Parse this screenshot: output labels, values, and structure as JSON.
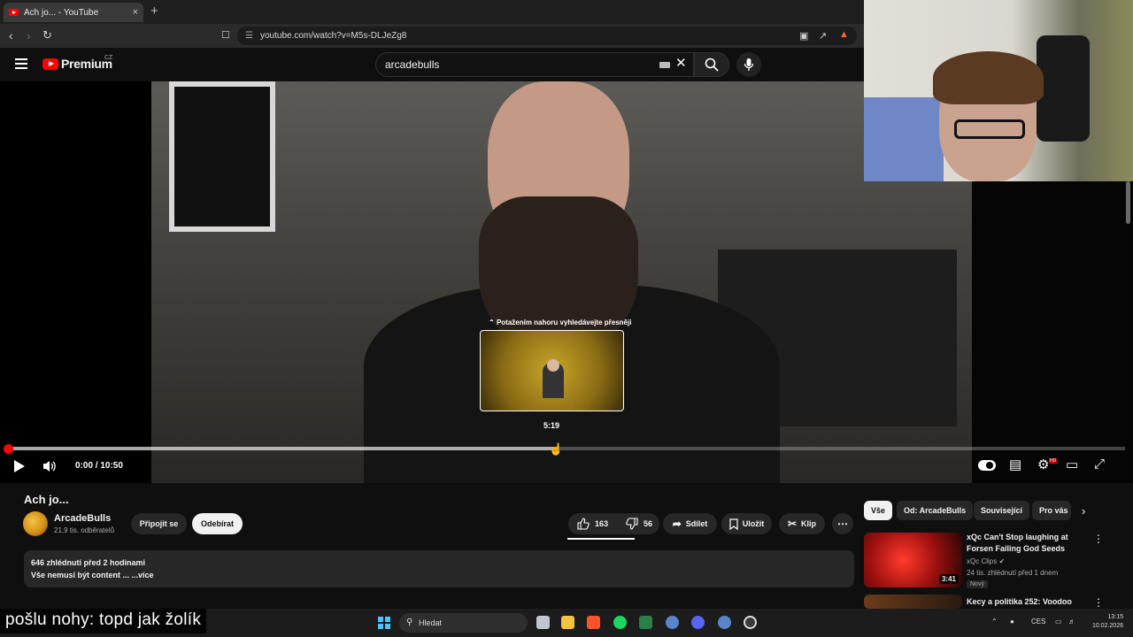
{
  "browser": {
    "tab_title": "Ach jo... - YouTube",
    "tab_close": "×",
    "new_tab": "+",
    "url": "youtube.com/watch?v=M5s-DLJeZg8"
  },
  "yt_header": {
    "logo_text": "Premium",
    "country": "CZ",
    "search_value": "arcadebulls"
  },
  "player": {
    "seek_hint": "Potažením nahoru vyhledávejte přesněji",
    "preview_time": "5:19",
    "time_display": "0:00 / 10:50",
    "hover_progress": 0.49,
    "played_progress": 0.0
  },
  "video_info": {
    "title": "Ach jo...",
    "channel": "ArcadeBulls",
    "subscribers": "21,9 tis. odběratelů",
    "join_label": "Připojit se",
    "subscribe_label": "Odebírat",
    "likes": "163",
    "dislikes": "56",
    "share_label": "Sdílet",
    "save_label": "Uložit",
    "clip_label": "Klip",
    "views_line": "646 zhlédnutí  před 2 hodinami",
    "desc_line": "Vše nemusí být content ...",
    "more_label": "...více"
  },
  "chips": [
    "Vše",
    "Od: ArcadeBulls",
    "Související",
    "Pro vás"
  ],
  "recommendations": [
    {
      "title": "xQc Can't Stop laughing at Forsen Failing God Seeds",
      "channel": "xQc Clips",
      "meta": "24 tis. zhlédnutí  před 1 dnem",
      "badge": "Nový",
      "duration": "3:41"
    },
    {
      "title": "Kecy a politika 252: Voodoo"
    }
  ],
  "caption_text": "pošlu nohy: topd jak žolík",
  "taskbar": {
    "search_placeholder": "Hledat",
    "language": "CES",
    "time": "13:15",
    "date": "10.02.2026"
  },
  "colors": {
    "yt_red": "#ff0000",
    "background": "#0f0f0f",
    "chip_bg": "#272727",
    "accent_blue": "#4cc2ff"
  }
}
